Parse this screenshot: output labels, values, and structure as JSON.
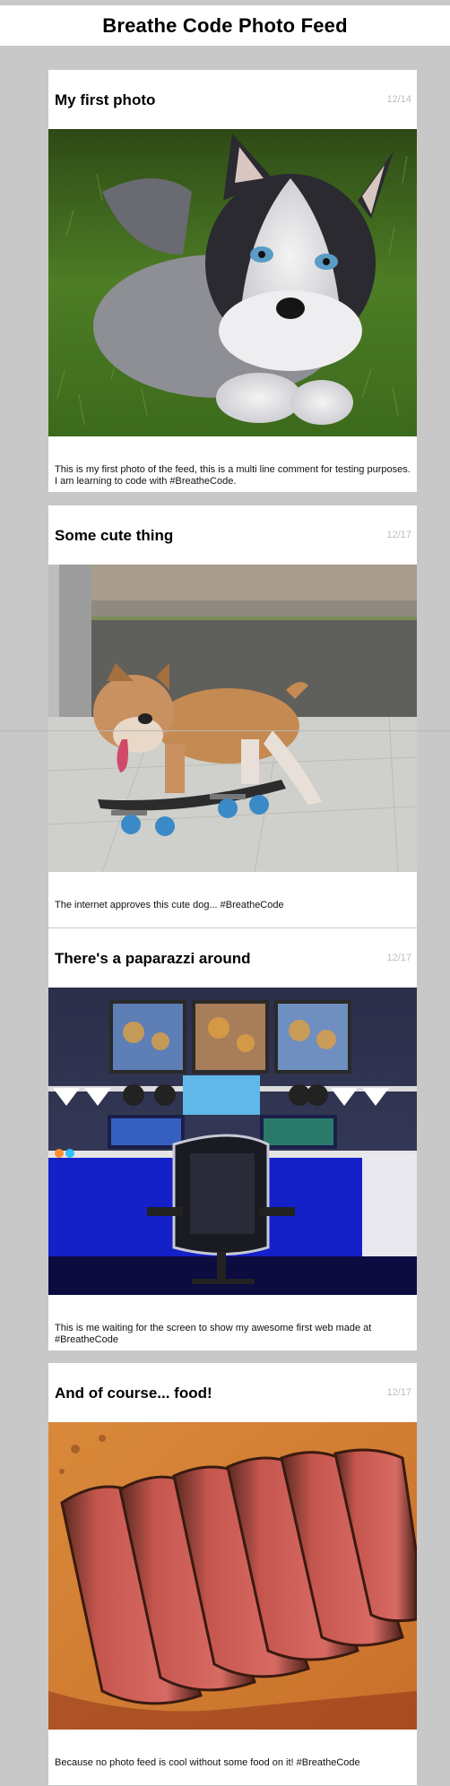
{
  "header": {
    "title": "Breathe Code Photo Feed"
  },
  "posts": [
    {
      "title": "My first photo",
      "date": "12/14",
      "image": "husky-puppy-on-grass",
      "caption": "This is my first photo of the feed, this is a multi line comment for testing purposes. I am learning to code with #BreatheCode."
    },
    {
      "title": "Some cute thing",
      "date": "12/17",
      "image": "bulldog-on-skateboard",
      "caption": "The internet approves this cute dog... #BreatheCode"
    },
    {
      "title": "There's a paparazzi around",
      "date": "12/17",
      "image": "gaming-room-setup",
      "caption": "This is me waiting for the screen to show my awesome first web made at #BreatheCode"
    },
    {
      "title": "And of course... food!",
      "date": "12/17",
      "image": "sliced-steak",
      "caption": "Because no photo feed is cool without some food on it! #BreatheCode"
    }
  ]
}
